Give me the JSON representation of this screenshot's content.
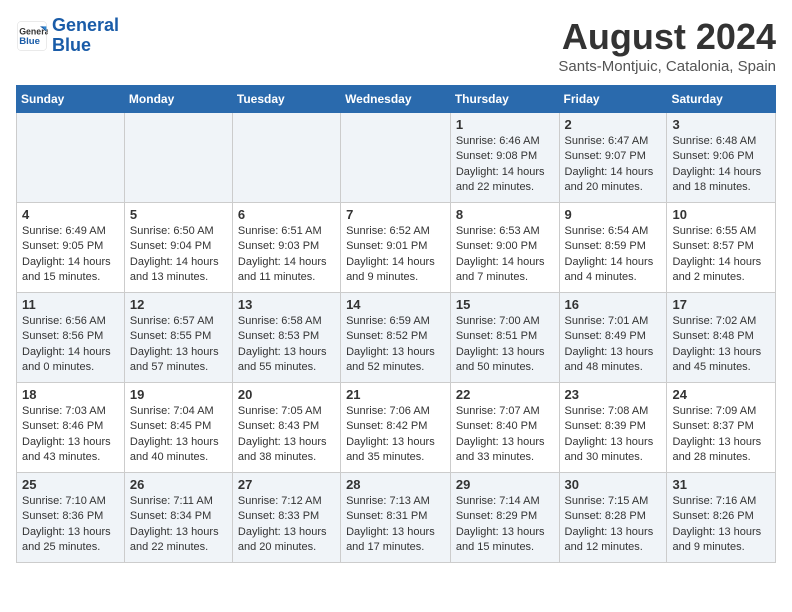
{
  "logo": {
    "text_general": "General",
    "text_blue": "Blue"
  },
  "title": {
    "month_year": "August 2024",
    "location": "Sants-Montjuic, Catalonia, Spain"
  },
  "header_days": [
    "Sunday",
    "Monday",
    "Tuesday",
    "Wednesday",
    "Thursday",
    "Friday",
    "Saturday"
  ],
  "weeks": [
    {
      "days": [
        {
          "num": "",
          "info": ""
        },
        {
          "num": "",
          "info": ""
        },
        {
          "num": "",
          "info": ""
        },
        {
          "num": "",
          "info": ""
        },
        {
          "num": "1",
          "info": "Sunrise: 6:46 AM\nSunset: 9:08 PM\nDaylight: 14 hours\nand 22 minutes."
        },
        {
          "num": "2",
          "info": "Sunrise: 6:47 AM\nSunset: 9:07 PM\nDaylight: 14 hours\nand 20 minutes."
        },
        {
          "num": "3",
          "info": "Sunrise: 6:48 AM\nSunset: 9:06 PM\nDaylight: 14 hours\nand 18 minutes."
        }
      ]
    },
    {
      "days": [
        {
          "num": "4",
          "info": "Sunrise: 6:49 AM\nSunset: 9:05 PM\nDaylight: 14 hours\nand 15 minutes."
        },
        {
          "num": "5",
          "info": "Sunrise: 6:50 AM\nSunset: 9:04 PM\nDaylight: 14 hours\nand 13 minutes."
        },
        {
          "num": "6",
          "info": "Sunrise: 6:51 AM\nSunset: 9:03 PM\nDaylight: 14 hours\nand 11 minutes."
        },
        {
          "num": "7",
          "info": "Sunrise: 6:52 AM\nSunset: 9:01 PM\nDaylight: 14 hours\nand 9 minutes."
        },
        {
          "num": "8",
          "info": "Sunrise: 6:53 AM\nSunset: 9:00 PM\nDaylight: 14 hours\nand 7 minutes."
        },
        {
          "num": "9",
          "info": "Sunrise: 6:54 AM\nSunset: 8:59 PM\nDaylight: 14 hours\nand 4 minutes."
        },
        {
          "num": "10",
          "info": "Sunrise: 6:55 AM\nSunset: 8:57 PM\nDaylight: 14 hours\nand 2 minutes."
        }
      ]
    },
    {
      "days": [
        {
          "num": "11",
          "info": "Sunrise: 6:56 AM\nSunset: 8:56 PM\nDaylight: 14 hours\nand 0 minutes."
        },
        {
          "num": "12",
          "info": "Sunrise: 6:57 AM\nSunset: 8:55 PM\nDaylight: 13 hours\nand 57 minutes."
        },
        {
          "num": "13",
          "info": "Sunrise: 6:58 AM\nSunset: 8:53 PM\nDaylight: 13 hours\nand 55 minutes."
        },
        {
          "num": "14",
          "info": "Sunrise: 6:59 AM\nSunset: 8:52 PM\nDaylight: 13 hours\nand 52 minutes."
        },
        {
          "num": "15",
          "info": "Sunrise: 7:00 AM\nSunset: 8:51 PM\nDaylight: 13 hours\nand 50 minutes."
        },
        {
          "num": "16",
          "info": "Sunrise: 7:01 AM\nSunset: 8:49 PM\nDaylight: 13 hours\nand 48 minutes."
        },
        {
          "num": "17",
          "info": "Sunrise: 7:02 AM\nSunset: 8:48 PM\nDaylight: 13 hours\nand 45 minutes."
        }
      ]
    },
    {
      "days": [
        {
          "num": "18",
          "info": "Sunrise: 7:03 AM\nSunset: 8:46 PM\nDaylight: 13 hours\nand 43 minutes."
        },
        {
          "num": "19",
          "info": "Sunrise: 7:04 AM\nSunset: 8:45 PM\nDaylight: 13 hours\nand 40 minutes."
        },
        {
          "num": "20",
          "info": "Sunrise: 7:05 AM\nSunset: 8:43 PM\nDaylight: 13 hours\nand 38 minutes."
        },
        {
          "num": "21",
          "info": "Sunrise: 7:06 AM\nSunset: 8:42 PM\nDaylight: 13 hours\nand 35 minutes."
        },
        {
          "num": "22",
          "info": "Sunrise: 7:07 AM\nSunset: 8:40 PM\nDaylight: 13 hours\nand 33 minutes."
        },
        {
          "num": "23",
          "info": "Sunrise: 7:08 AM\nSunset: 8:39 PM\nDaylight: 13 hours\nand 30 minutes."
        },
        {
          "num": "24",
          "info": "Sunrise: 7:09 AM\nSunset: 8:37 PM\nDaylight: 13 hours\nand 28 minutes."
        }
      ]
    },
    {
      "days": [
        {
          "num": "25",
          "info": "Sunrise: 7:10 AM\nSunset: 8:36 PM\nDaylight: 13 hours\nand 25 minutes."
        },
        {
          "num": "26",
          "info": "Sunrise: 7:11 AM\nSunset: 8:34 PM\nDaylight: 13 hours\nand 22 minutes."
        },
        {
          "num": "27",
          "info": "Sunrise: 7:12 AM\nSunset: 8:33 PM\nDaylight: 13 hours\nand 20 minutes."
        },
        {
          "num": "28",
          "info": "Sunrise: 7:13 AM\nSunset: 8:31 PM\nDaylight: 13 hours\nand 17 minutes."
        },
        {
          "num": "29",
          "info": "Sunrise: 7:14 AM\nSunset: 8:29 PM\nDaylight: 13 hours\nand 15 minutes."
        },
        {
          "num": "30",
          "info": "Sunrise: 7:15 AM\nSunset: 8:28 PM\nDaylight: 13 hours\nand 12 minutes."
        },
        {
          "num": "31",
          "info": "Sunrise: 7:16 AM\nSunset: 8:26 PM\nDaylight: 13 hours\nand 9 minutes."
        }
      ]
    }
  ]
}
